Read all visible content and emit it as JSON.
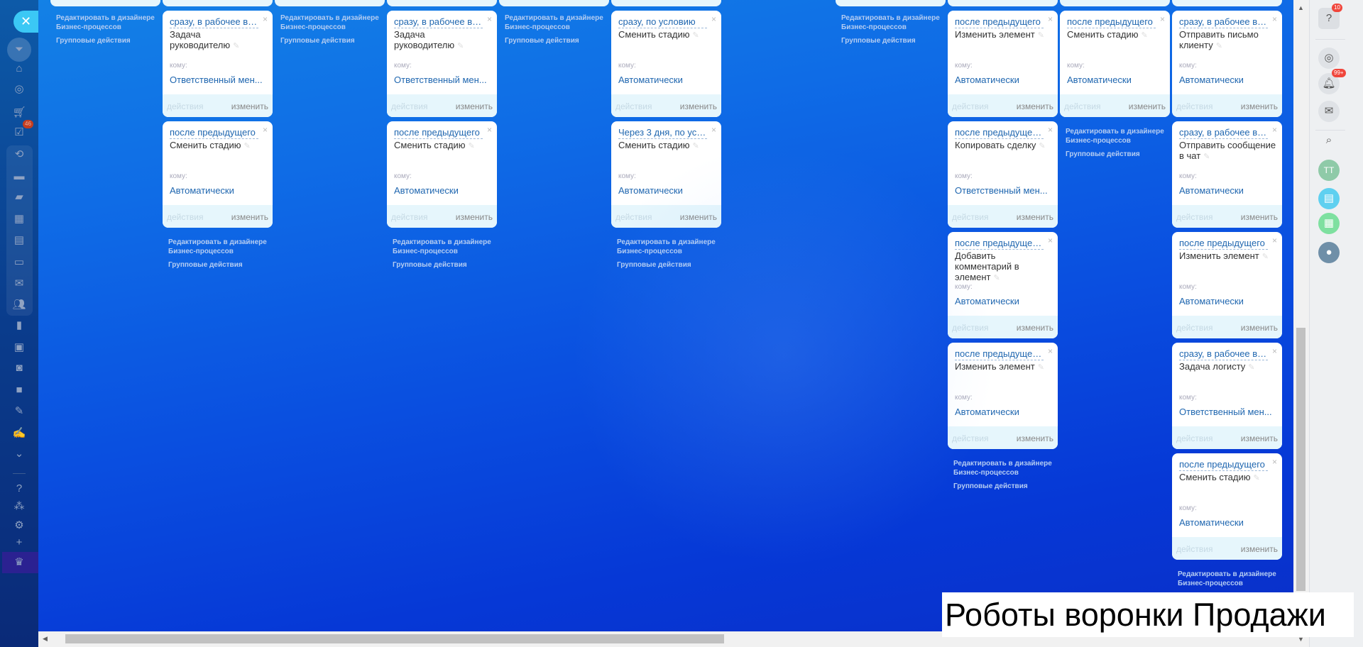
{
  "common": {
    "to_label": "кому:",
    "actions_label": "действия",
    "edit_label": "изменить",
    "close_glyph": "×",
    "edit_designer_link": "Редактировать в дизайнере Бизнес-процессов",
    "group_actions_link": "Групповые действия"
  },
  "columns": [
    {
      "has_stub": true,
      "cards": [],
      "links": true,
      "group": true
    },
    {
      "has_stub": true,
      "cards": [
        {
          "trigger": "сразу, в рабочее врем...",
          "title": "Задача руководителю",
          "to": "Ответственный мен..."
        },
        {
          "trigger": "после предыдущего",
          "title": "Сменить стадию",
          "to": "Автоматически"
        }
      ],
      "links": true,
      "group": true
    },
    {
      "has_stub": true,
      "cards": [],
      "links": true,
      "group": true
    },
    {
      "has_stub": true,
      "cards": [
        {
          "trigger": "сразу, в рабочее врем...",
          "title": "Задача руководителю",
          "to": "Ответственный мен..."
        },
        {
          "trigger": "после предыдущего",
          "title": "Сменить стадию",
          "to": "Автоматически"
        }
      ],
      "links": true,
      "group": true
    },
    {
      "has_stub": true,
      "cards": [],
      "links": true,
      "group": true
    },
    {
      "has_stub": true,
      "cards": [
        {
          "trigger": "сразу, по условию",
          "title": "Сменить стадию",
          "to": "Автоматически"
        },
        {
          "trigger": "Через 3 дня, по услов...",
          "title": "Сменить стадию",
          "to": "Автоматически"
        }
      ],
      "links": true,
      "group": true
    },
    {
      "has_stub": false,
      "cards": [],
      "links": false,
      "group": false
    },
    {
      "has_stub": true,
      "cards": [],
      "links": true,
      "group": true
    },
    {
      "has_stub": true,
      "cards": [
        {
          "trigger": "после предыдущего",
          "title": "Изменить элемент",
          "to": "Автоматически"
        },
        {
          "trigger": "после предыдущего, п...",
          "title": "Копировать сделку",
          "to": "Ответственный мен..."
        },
        {
          "trigger": "после предыдущего, п...",
          "title": "Добавить комментарий в элемент",
          "to": "Автоматически"
        },
        {
          "trigger": "после предыдущего, п...",
          "title": "Изменить элемент",
          "to": "Автоматически"
        }
      ],
      "links": true,
      "group": true
    },
    {
      "has_stub": true,
      "cards": [
        {
          "trigger": "после предыдущего",
          "title": "Сменить стадию",
          "to": "Автоматически"
        }
      ],
      "links": true,
      "group": true
    },
    {
      "has_stub": true,
      "cards": [
        {
          "trigger": "сразу, в рабочее врем...",
          "title": "Отправить письмо клиенту",
          "to": "Автоматически"
        },
        {
          "trigger": "сразу, в рабочее врем...",
          "title": "Отправить сообщение в чат",
          "to": "Автоматически"
        },
        {
          "trigger": "после предыдущего",
          "title": "Изменить элемент",
          "to": "Автоматически"
        },
        {
          "trigger": "сразу, в рабочее врем...",
          "title": "Задача логисту",
          "to": "Ответственный мен..."
        },
        {
          "trigger": "после предыдущего",
          "title": "Сменить стадию",
          "to": "Автоматически"
        }
      ],
      "links": true,
      "group": false
    }
  ],
  "sidebar": {
    "close_glyph": "✕",
    "items": [
      {
        "icon": "filter-icon"
      },
      {
        "icon": "home-icon"
      },
      {
        "icon": "target-icon"
      },
      {
        "icon": "cart-icon"
      },
      {
        "icon": "tasks-icon",
        "badge": "46"
      },
      {
        "icon": "crm-icon"
      },
      {
        "icon": "drive-icon"
      },
      {
        "icon": "chat-icon"
      },
      {
        "icon": "calendar-icon"
      },
      {
        "icon": "document-icon"
      },
      {
        "icon": "inbox-icon"
      },
      {
        "icon": "mail-icon"
      },
      {
        "icon": "group-icon"
      },
      {
        "icon": "analytics-icon"
      },
      {
        "icon": "contact-card-icon"
      },
      {
        "icon": "robot-icon"
      },
      {
        "icon": "box-icon"
      },
      {
        "icon": "edit-document-icon"
      },
      {
        "icon": "signature-icon"
      },
      {
        "icon": "chevron-down-circle-icon"
      },
      {
        "icon": "help-icon"
      },
      {
        "icon": "sitemap-icon"
      },
      {
        "icon": "gear-icon"
      },
      {
        "icon": "plus-icon"
      },
      {
        "icon": "crown-icon"
      }
    ]
  },
  "right_panel": {
    "help_badge": "10",
    "notifications_badge": "99+",
    "avatar_initials": "TT"
  },
  "overlay_label": "Роботы воронки Продажи",
  "colors": {
    "accent": "#3bc8f5",
    "link": "#2067b0",
    "card_footer": "#e6f6fc"
  }
}
